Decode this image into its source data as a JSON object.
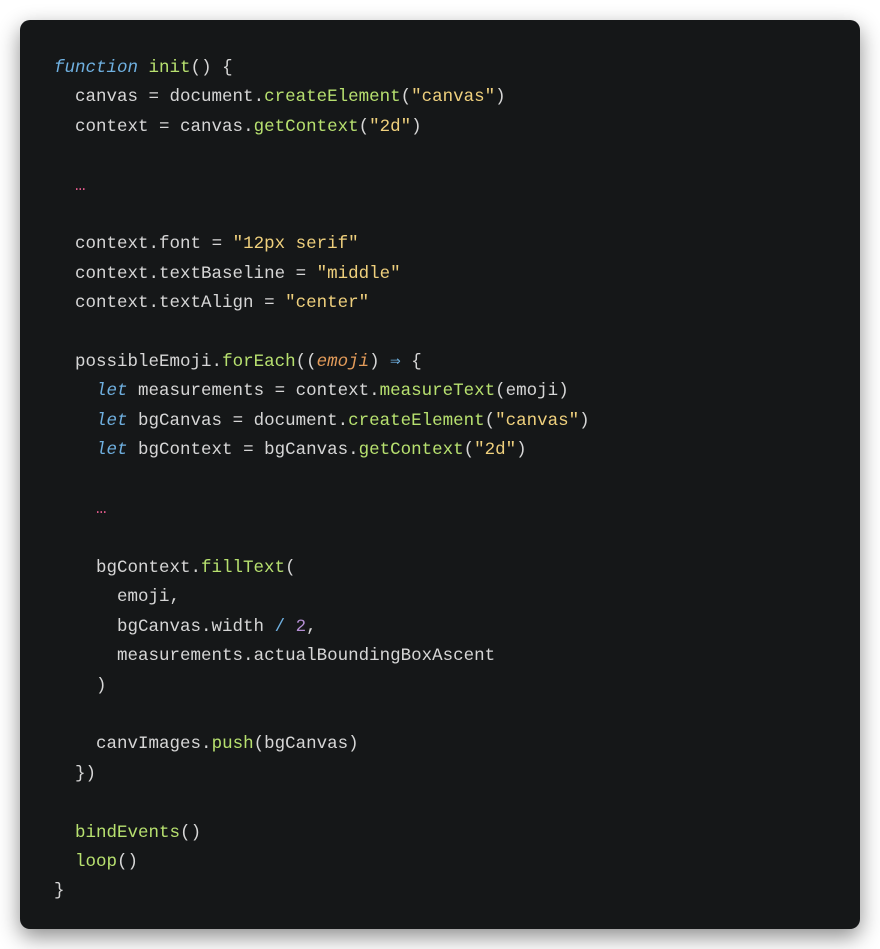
{
  "code": {
    "kw_function": "function",
    "fn_init": "init",
    "id_canvas": "canvas",
    "id_document": "document",
    "m_createElement": "createElement",
    "s_canvas": "\"canvas\"",
    "id_context": "context",
    "m_getContext": "getContext",
    "s_2d": "\"2d\"",
    "ellipsis": "…",
    "p_font": "font",
    "s_font": "\"12px serif\"",
    "p_textBaseline": "textBaseline",
    "s_middle": "\"middle\"",
    "p_textAlign": "textAlign",
    "s_center": "\"center\"",
    "id_possibleEmoji": "possibleEmoji",
    "m_forEach": "forEach",
    "param_emoji": "emoji",
    "arrow": "⇒",
    "kw_let": "let",
    "id_measurements": "measurements",
    "m_measureText": "measureText",
    "id_emoji": "emoji",
    "id_bgCanvas": "bgCanvas",
    "id_bgContext": "bgContext",
    "m_fillText": "fillText",
    "p_width": "width",
    "op_div": "/",
    "num_2": "2",
    "p_aBBA": "actualBoundingBoxAscent",
    "id_canvImages": "canvImages",
    "m_push": "push",
    "fn_bindEvents": "bindEvents",
    "fn_loop": "loop",
    "eq": " = ",
    "p_open": "(",
    "p_close": ")",
    "b_open": "{",
    "b_close": "}",
    "dot": ".",
    "comma": ",",
    "space": " ",
    "ind1": "  ",
    "ind2": "    ",
    "ind3": "      "
  }
}
